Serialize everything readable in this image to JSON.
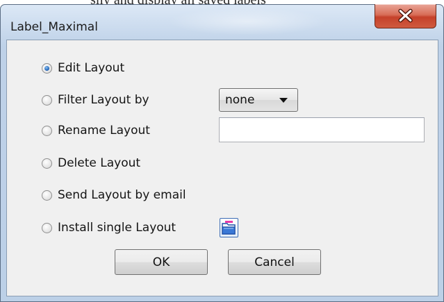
{
  "background_window": {
    "partial_text": "sily and display all saved labels"
  },
  "window": {
    "title": "Label_Maximal",
    "close_icon": "close-x-icon"
  },
  "options": [
    {
      "label": "Edit Layout",
      "selected": true
    },
    {
      "label": "Filter Layout by",
      "selected": false
    },
    {
      "label": "Rename Layout",
      "selected": false
    },
    {
      "label": "Delete Layout",
      "selected": false
    },
    {
      "label": "Send Layout by email",
      "selected": false
    },
    {
      "label": "Install single Layout",
      "selected": false
    }
  ],
  "filter_select": {
    "value": "none"
  },
  "rename_input": {
    "value": ""
  },
  "install_button": {
    "icon": "folder-open-icon"
  },
  "buttons": {
    "ok": "OK",
    "cancel": "Cancel"
  },
  "colors": {
    "close_button": "#c5412a",
    "radio_selected": "#2c6fc0",
    "folder_icon": "#2a62c4"
  }
}
